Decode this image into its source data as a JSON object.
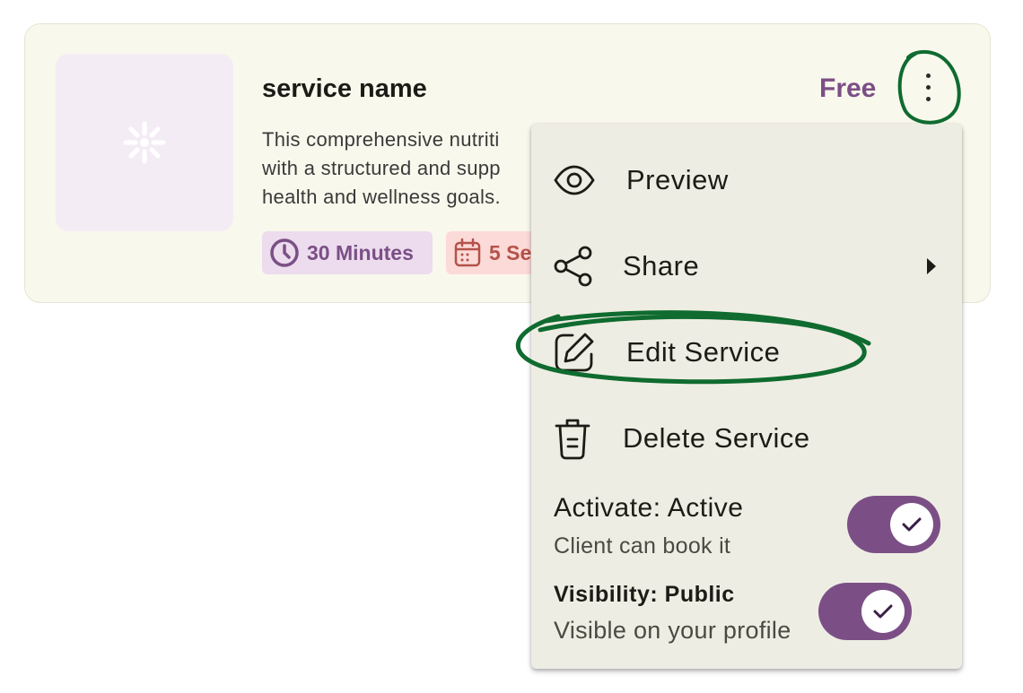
{
  "card": {
    "title": "service name",
    "price": "Free",
    "description_lines": [
      "This comprehensive nutriti",
      "with a structured and supp",
      "health and wellness goals."
    ],
    "chips": {
      "duration": "30 Minutes",
      "sessions": "5 Se"
    }
  },
  "menu": {
    "items": [
      {
        "label": "Preview",
        "icon": "eye-icon"
      },
      {
        "label": "Share",
        "icon": "share-icon"
      },
      {
        "label": "Edit Service",
        "icon": "edit-icon"
      },
      {
        "label": "Delete Service",
        "icon": "trash-icon"
      }
    ],
    "activate": {
      "title": "Activate: Active",
      "subtitle": "Client can book it",
      "on": true
    },
    "visibility": {
      "title_prefix": "Visibility:",
      "title_value": "Public",
      "subtitle": "Visible on your profile",
      "on": true
    }
  },
  "colors": {
    "accent": "#7b4f86",
    "card_bg": "#f9f8ec",
    "menu_bg": "#eeede3",
    "annotation": "#0f6b2f",
    "chip_duration_bg": "#ecdcee",
    "chip_sessions_bg": "#fbdad8"
  }
}
